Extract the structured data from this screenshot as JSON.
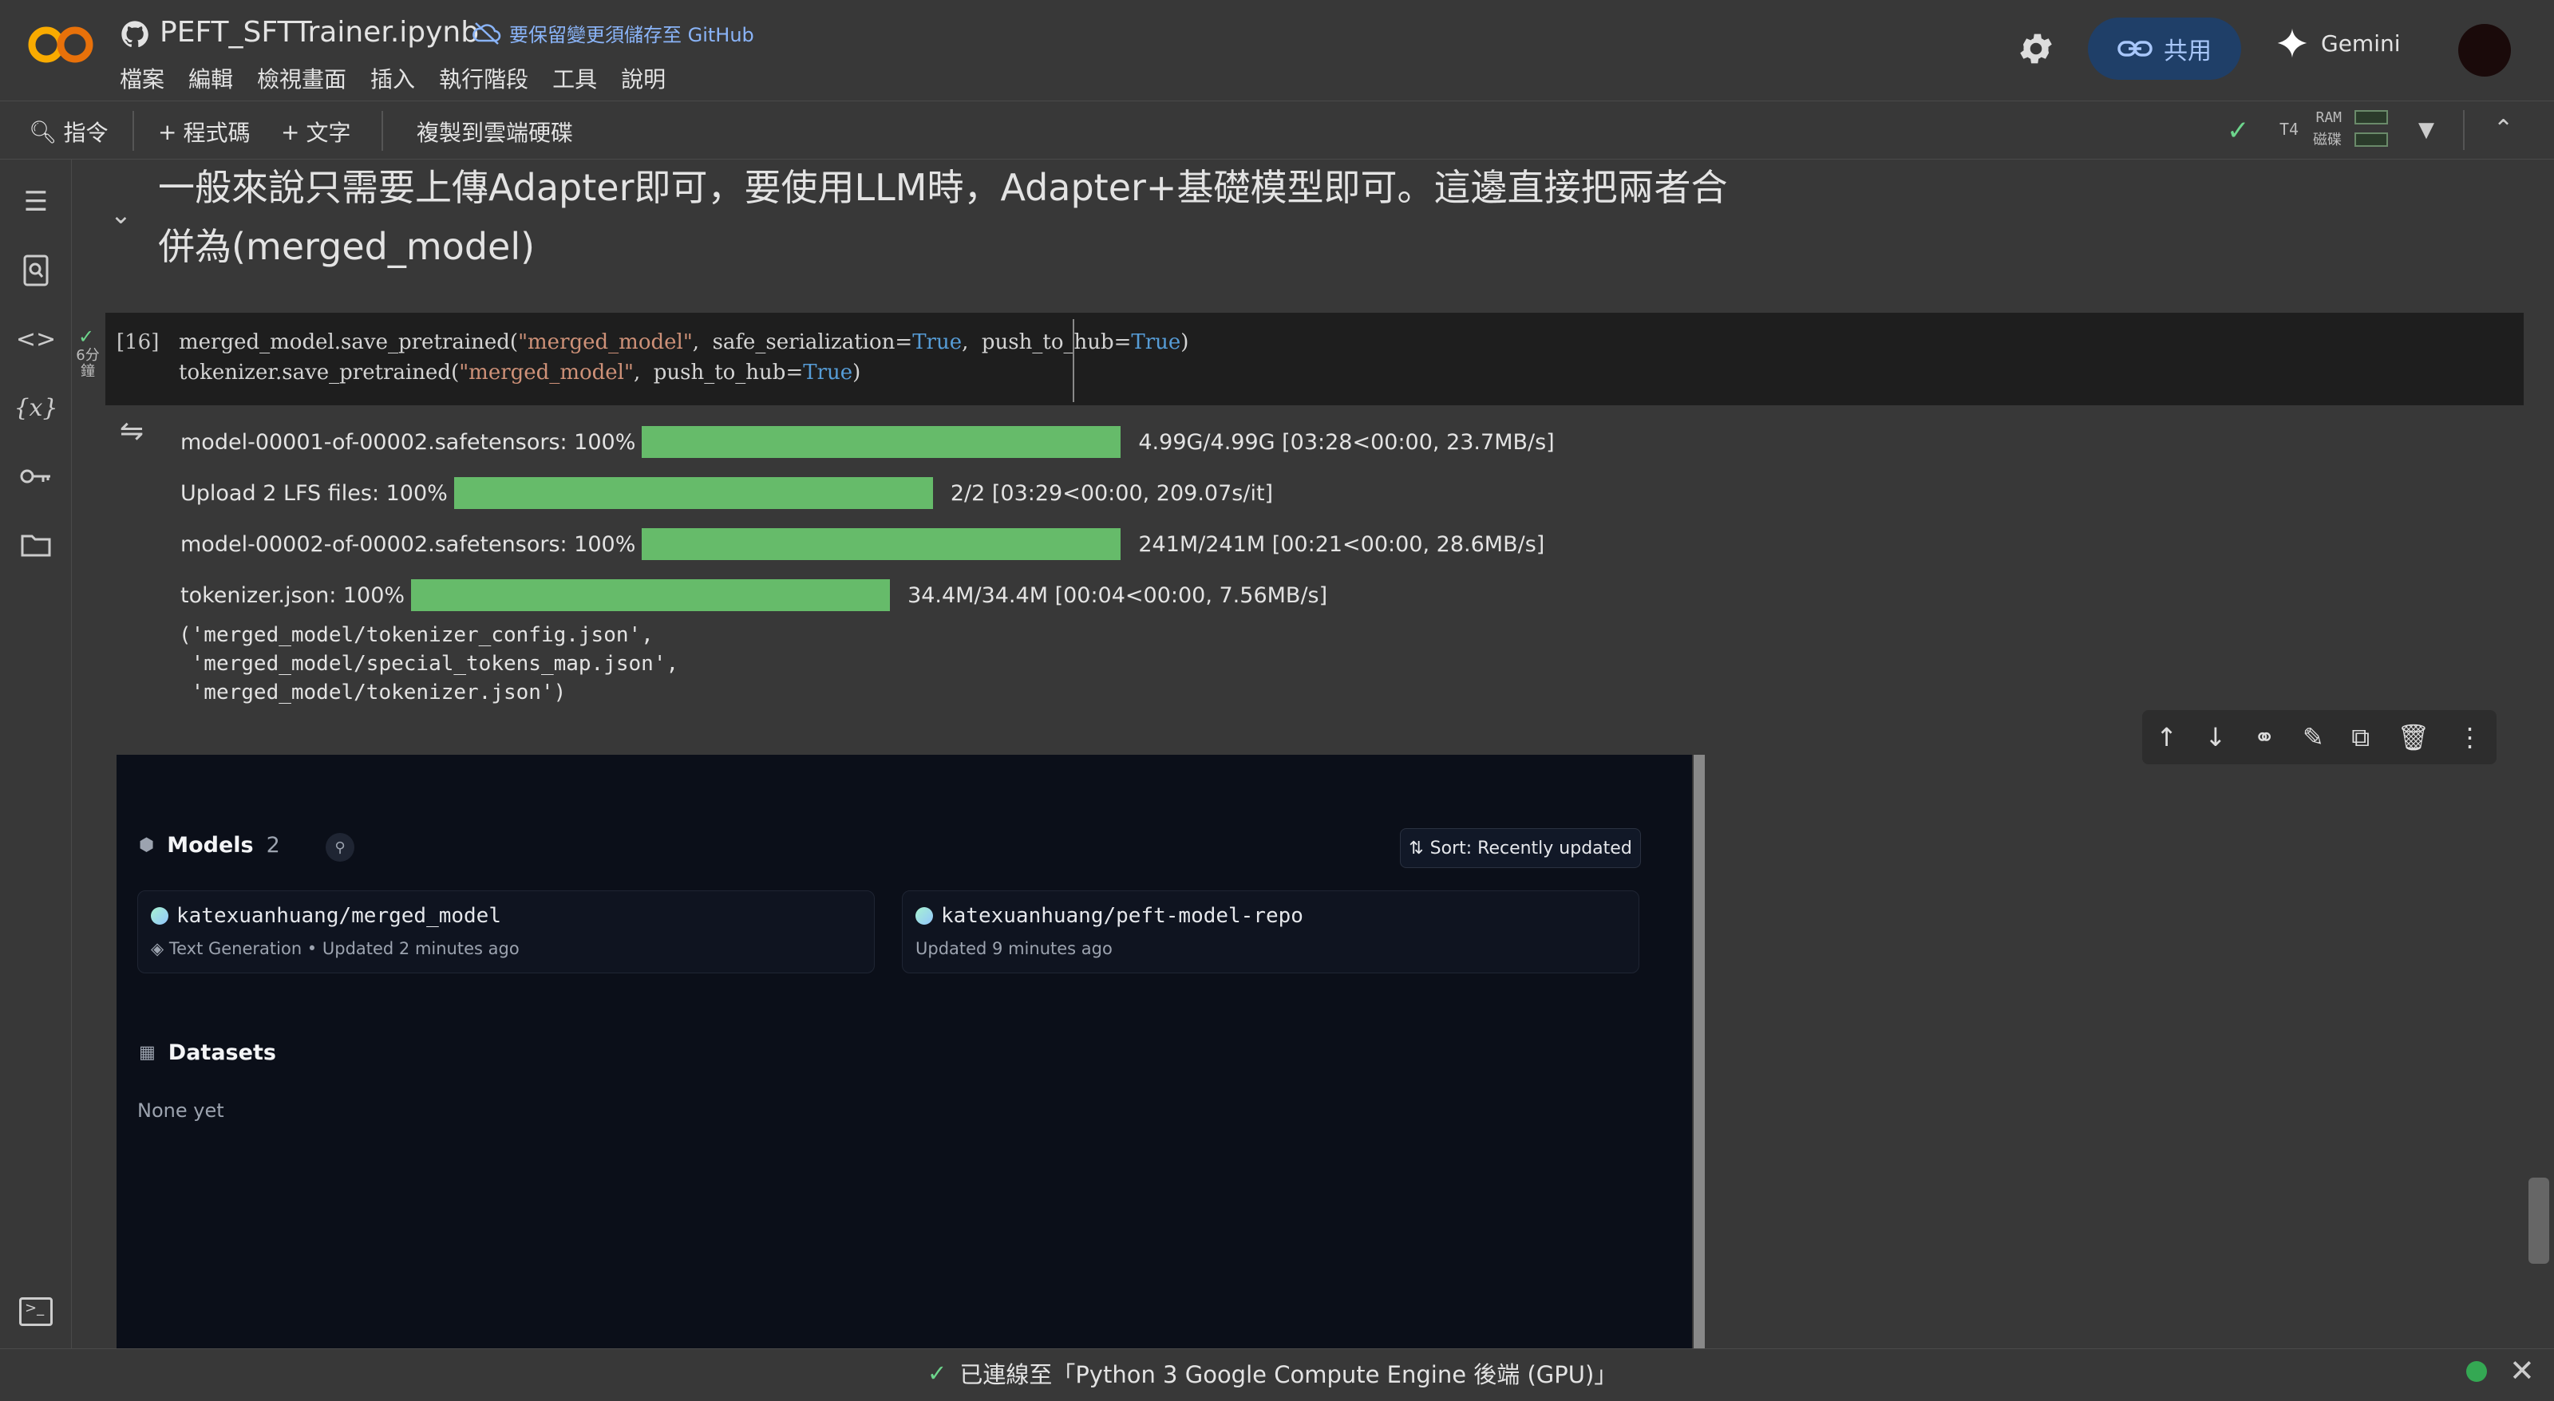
{
  "app": {
    "notebook_title": "PEFT_SFTTrainer.ipynb",
    "save_note": "要保留變更須儲存至 GitHub",
    "menu": [
      "檔案",
      "編輯",
      "檢視畫面",
      "插入",
      "執行階段",
      "工具",
      "說明"
    ],
    "share_label": "共用",
    "gemini_label": "Gemini"
  },
  "toolbar": {
    "command_label": "指令",
    "add_code_label": "程式碼",
    "add_text_label": "文字",
    "copy_drive_label": "複製到雲端硬碟",
    "runtime": "T4",
    "ram_label": "RAM",
    "disk_label": "磁碟"
  },
  "text_cell": {
    "heading": "一般來說只需要上傳Adapter即可，要使用LLM時，Adapter+基礎模型即可。這邊直接把兩者合併為(merged_model)"
  },
  "code_cell": {
    "exec_count": "[16]",
    "exec_time": "6分鐘",
    "lines": [
      {
        "pre": "merged_model.save_pretrained(",
        "str": "\"merged_model\"",
        "mid": ",  safe_serialization=",
        "kw1": "True",
        "mid2": ",  push_to_hub=",
        "kw2": "True",
        "post": ")"
      },
      {
        "pre": "tokenizer.save_pretrained(",
        "str": "\"merged_model\"",
        "mid": ",  push_to_hub=",
        "kw1": "True",
        "mid2": "",
        "kw2": "",
        "post": ")"
      }
    ]
  },
  "progress": [
    {
      "label": "model-00001-of-00002.safetensors: 100%",
      "stats": "4.99G/4.99G  [03:28<00:00,  23.7MB/s]",
      "fraction": 1.0
    },
    {
      "label": "Upload  2  LFS  files: 100%",
      "stats": "2/2  [03:29<00:00,  209.07s/it]",
      "fraction": 1.0
    },
    {
      "label": "model-00002-of-00002.safetensors: 100%",
      "stats": "241M/241M  [00:21<00:00,  28.6MB/s]",
      "fraction": 1.0
    },
    {
      "label": "tokenizer.json: 100%",
      "stats": "34.4M/34.4M  [00:04<00:00,  7.56MB/s]",
      "fraction": 1.0
    }
  ],
  "output_tuple": "('merged_model/tokenizer_config.json',\n 'merged_model/special_tokens_map.json',\n 'merged_model/tokenizer.json')",
  "hf": {
    "models_label": "Models",
    "models_count": "2",
    "sort_label": "Sort:  Recently updated",
    "cards": [
      {
        "name": "katexuanhuang/merged_model",
        "meta": "Text Generation  •  Updated 2 minutes ago"
      },
      {
        "name": "katexuanhuang/peft-model-repo",
        "meta": "Updated 9 minutes ago"
      }
    ],
    "datasets_label": "Datasets",
    "datasets_empty": "None yet"
  },
  "status": {
    "text": "已連線至「Python 3 Google Compute Engine 後端 (GPU)」"
  }
}
